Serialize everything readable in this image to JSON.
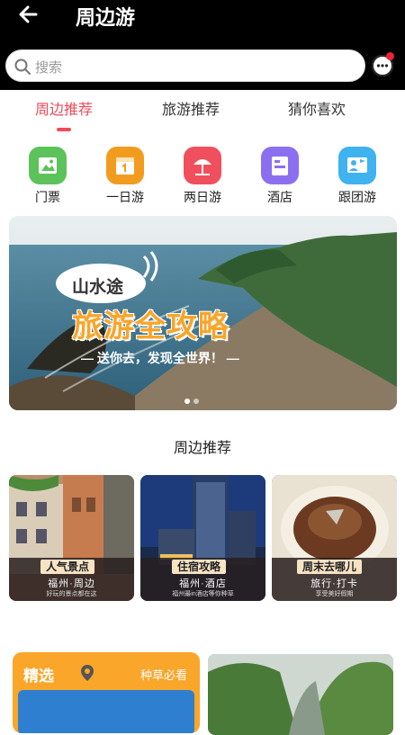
{
  "header": {
    "title": "周边游"
  },
  "search": {
    "placeholder": "搜索"
  },
  "tabs": [
    {
      "label": "周边推荐"
    },
    {
      "label": "旅游推荐"
    },
    {
      "label": "猜你喜欢"
    }
  ],
  "categories": [
    {
      "label": "门票",
      "icon": "ticket-icon",
      "color": "#5cc25a"
    },
    {
      "label": "一日游",
      "icon": "calendar-icon",
      "color": "#f29c1f"
    },
    {
      "label": "两日游",
      "icon": "beach-umbrella-icon",
      "color": "#f0505d"
    },
    {
      "label": "酒店",
      "icon": "hotel-icon",
      "color": "#8c6ff0"
    },
    {
      "label": "跟团游",
      "icon": "flag-icon",
      "color": "#3fb2f0"
    }
  ],
  "banner": {
    "badge": "山水途",
    "headline": "旅游全攻略",
    "tagline": "送你去，发现全世界！"
  },
  "section": {
    "title": "周边推荐"
  },
  "cards": [
    {
      "tag": "人气景点",
      "sub": "福州·周边",
      "tiny": "好玩的景点都在这"
    },
    {
      "tag": "住宿攻略",
      "sub": "福州·酒店",
      "tiny": "福州最in酒店等你种草"
    },
    {
      "tag": "周末去哪儿",
      "sub": "旅行·打卡",
      "tiny": "享受美好假期"
    }
  ],
  "featured": {
    "label": "精选",
    "right": "种草必看"
  }
}
